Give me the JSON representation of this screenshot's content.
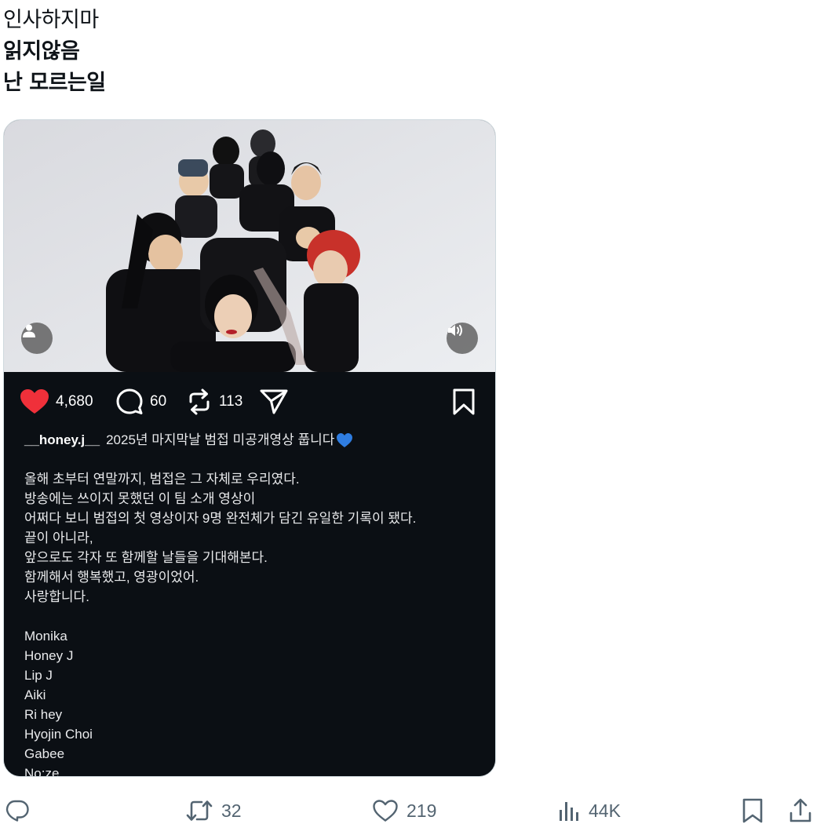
{
  "tweet": {
    "lines": [
      "인사하지마",
      "읽지않음",
      "난 모르는일"
    ]
  },
  "media": {
    "video": {
      "profile_icon": "person-icon",
      "sound_icon": "speaker-icon"
    },
    "post": {
      "likes": "4,680",
      "comments": "60",
      "reposts": "113",
      "username": "__honey.j__",
      "title": "2025년 마지막날 범접 미공개영상 풉니다",
      "title_emoji": "blue-heart",
      "body_lines": [
        "올해 초부터 연말까지, 범접은 그 자체로 우리였다.",
        "방송에는 쓰이지 못했던 이 팀 소개 영상이",
        "어쩌다 보니 범접의 첫 영상이자 9명 완전체가 담긴 유일한 기록이 됐다.",
        "끝이 아니라,",
        "앞으로도 각자 또 함께할 날들을 기대해본다.",
        "함께해서 행복했고, 영광이었어.",
        "사랑합니다.",
        "",
        "Monika",
        "Honey J",
        "Lip J",
        "Aiki",
        "Ri hey",
        "Hyojin Choi",
        "Gabee",
        "No:ze"
      ]
    }
  },
  "tweet_actions": {
    "replies": "",
    "retweets": "32",
    "likes": "219",
    "views": "44K"
  },
  "colors": {
    "like_red": "#f0303a",
    "post_bg": "#0b0f14",
    "icon_gray": "#536471",
    "blue_heart": "#2f7de1"
  }
}
